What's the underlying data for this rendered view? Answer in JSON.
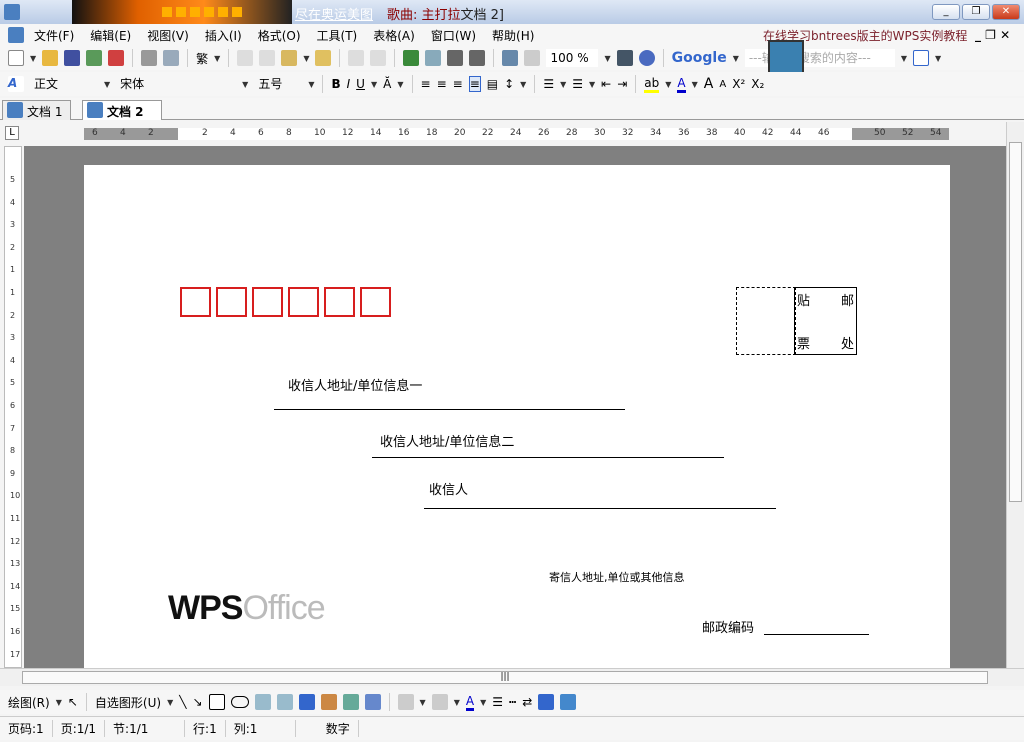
{
  "titlebar": {
    "link": "尽在奥运美图",
    "song": "歌曲: 主打拉",
    "doc": "文档 2]",
    "minimize": "_",
    "restore": "❐",
    "close": "✕"
  },
  "menu": {
    "items": [
      "文件(F)",
      "编辑(E)",
      "视图(V)",
      "插入(I)",
      "格式(O)",
      "工具(T)",
      "表格(A)",
      "窗口(W)",
      "帮助(H)"
    ],
    "promo": "在线学习bntrees版主的WPS实例教程"
  },
  "toolbar": {
    "traditional": "繁",
    "zoom": "100 %",
    "google": "Google",
    "search_placeholder": "---输入要搜索的内容---"
  },
  "format": {
    "style": "正文",
    "font": "宋体",
    "size": "五号",
    "bold": "B",
    "italic": "I",
    "underline": "U",
    "font_color": "A",
    "grow": "A",
    "shrink": "A",
    "superscript": "X²",
    "subscript": "X₂"
  },
  "tabs": [
    {
      "label": "文档 1"
    },
    {
      "label": "文档 2",
      "active": true
    }
  ],
  "ruler": {
    "ticks": [
      "6",
      "4",
      "2",
      "2",
      "4",
      "6",
      "8",
      "10",
      "12",
      "14",
      "16",
      "18",
      "20",
      "22",
      "24",
      "26",
      "28",
      "30",
      "32",
      "34",
      "36",
      "38",
      "40",
      "42",
      "44",
      "46",
      "50",
      "52",
      "54"
    ],
    "vticks": [
      "5",
      "4",
      "3",
      "2",
      "1",
      "1",
      "2",
      "3",
      "4",
      "5",
      "6",
      "7",
      "8",
      "9",
      "10",
      "11",
      "12",
      "13",
      "14",
      "15",
      "16",
      "17"
    ]
  },
  "envelope": {
    "stamp": [
      "贴",
      "邮",
      "票",
      "处"
    ],
    "recipient_address_1": "收信人地址/单位信息一",
    "recipient_address_2": "收信人地址/单位信息二",
    "recipient": "收信人",
    "sender": "寄信人地址,单位或其他信息",
    "postcode_label": "邮政编码",
    "logo": "WPS Office",
    "zip_color": "#d71e1e"
  },
  "draw": {
    "draw_label": "绘图(R)",
    "autoshape_label": "自选图形(U)"
  },
  "status": {
    "page_code": "页码:1",
    "page": "页:1/1",
    "section": "节:1/1",
    "row": "行:1",
    "col": "列:1",
    "mode": "数字"
  }
}
